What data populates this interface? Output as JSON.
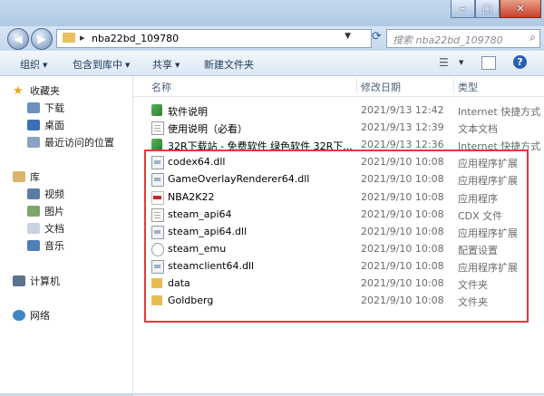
{
  "window": {
    "min_label": "–",
    "max_label": "□",
    "close_label": "✕"
  },
  "address": {
    "path": "nba22bd_109780",
    "separator": "▸",
    "search_placeholder": "搜索 nba22bd_109780"
  },
  "toolbar": {
    "organize": "组织",
    "include_in_library": "包含到库中",
    "share": "共享",
    "new_folder": "新建文件夹",
    "help": "?"
  },
  "nav": {
    "favorites": "收藏夹",
    "downloads": "下载",
    "desktop": "桌面",
    "recent": "最近访问的位置",
    "library": "库",
    "video": "视频",
    "pictures": "图片",
    "documents": "文档",
    "music": "音乐",
    "computer": "计算机",
    "network": "网络"
  },
  "columns": {
    "name": "名称",
    "date": "修改日期",
    "type": "类型"
  },
  "files": [
    {
      "name": "软件说明",
      "date": "2021/9/13 12:42",
      "type": "Internet 快捷方式",
      "icon": "link"
    },
    {
      "name": "使用说明（必看）",
      "date": "2021/9/13 12:39",
      "type": "文本文档",
      "icon": "txt"
    },
    {
      "name": "32R下载站 - 免费软件  绿色软件  32R下...",
      "date": "2021/9/13 12:36",
      "type": "Internet 快捷方式",
      "icon": "link"
    },
    {
      "name": "codex64.dll",
      "date": "2021/9/10 10:08",
      "type": "应用程序扩展",
      "icon": "dll"
    },
    {
      "name": "GameOverlayRenderer64.dll",
      "date": "2021/9/10 10:08",
      "type": "应用程序扩展",
      "icon": "dll"
    },
    {
      "name": "NBA2K22",
      "date": "2021/9/10 10:08",
      "type": "应用程序",
      "icon": "exe"
    },
    {
      "name": "steam_api64",
      "date": "2021/9/10 10:08",
      "type": "CDX 文件",
      "icon": "txt"
    },
    {
      "name": "steam_api64.dll",
      "date": "2021/9/10 10:08",
      "type": "应用程序扩展",
      "icon": "dll"
    },
    {
      "name": "steam_emu",
      "date": "2021/9/10 10:08",
      "type": "配置设置",
      "icon": "gear"
    },
    {
      "name": "steamclient64.dll",
      "date": "2021/9/10 10:08",
      "type": "应用程序扩展",
      "icon": "dll"
    },
    {
      "name": "data",
      "date": "2021/9/10 10:08",
      "type": "文件夹",
      "icon": "folder"
    },
    {
      "name": "Goldberg",
      "date": "2021/9/10 10:08",
      "type": "文件夹",
      "icon": "folder"
    }
  ],
  "colors": {
    "highlight_border": "#e03a3a",
    "folder": "#e6bd55",
    "accent": "#2a5fb5"
  }
}
